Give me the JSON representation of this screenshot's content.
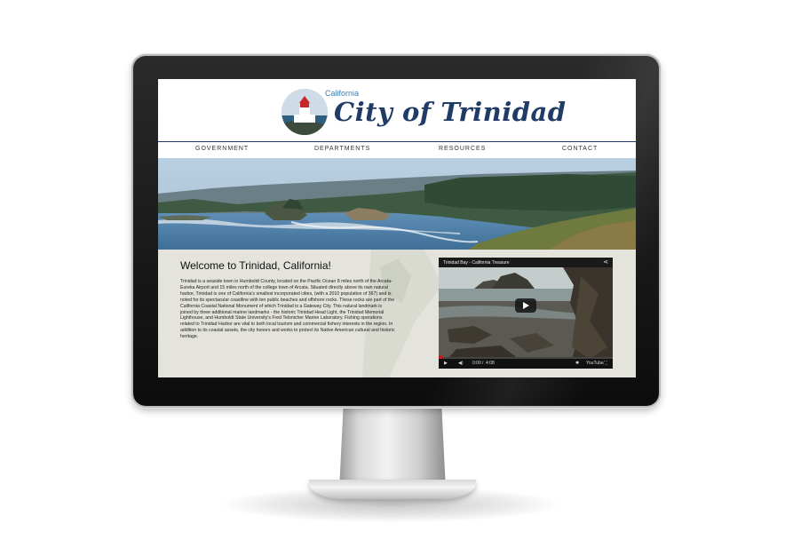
{
  "site": {
    "logo_subtitle": "California",
    "logo_title": "City of Trinidad"
  },
  "nav": {
    "items": [
      "GOVERNMENT",
      "DEPARTMENTS",
      "RESOURCES",
      "CONTACT"
    ]
  },
  "main": {
    "heading": "Welcome to Trinidad, California!",
    "body": "Trinidad is a seaside town in Humboldt County, located on the Pacific Ocean 8 miles north of the Arcata-Eureka Airport and 15 miles north of the college town of Arcata. Situated directly above its own natural harbor, Trinidad is one of California's smallest incorporated cities, (with a 2010 population of 367) and is noted for its spectacular coastline with ten public beaches and offshore rocks. These rocks are part of the California Coastal National Monument of which Trinidad is a Gateway City. This natural landmark is joined by three additional marine landmarks - the historic Trinidad Head Light, the Trinidad Memorial Lighthouse, and Humboldt State University's Fred Telonicher Marine Laboratory. Fishing operations related to Trinidad Harbor are vital to both local tourism and commercial fishery interests in the region. In addition to its coastal assets, the city honors and works to protect its Native American cultural and historic heritage."
  },
  "video": {
    "title": "Trinidad Bay - California Treasure",
    "current_time": "0:00",
    "duration": "4:08",
    "time_separator": "/",
    "youtube_label": "YouTube",
    "progress": 0
  },
  "icons": {
    "share": "share-icon",
    "play": "play-icon",
    "volume": "volume-icon",
    "settings": "gear-icon",
    "fullscreen": "fullscreen-icon"
  },
  "colors": {
    "brand_navy": "#1f3b66",
    "brand_blue": "#3f7fb7",
    "lighthouse_red": "#c62828",
    "youtube_red": "#cc181e"
  }
}
